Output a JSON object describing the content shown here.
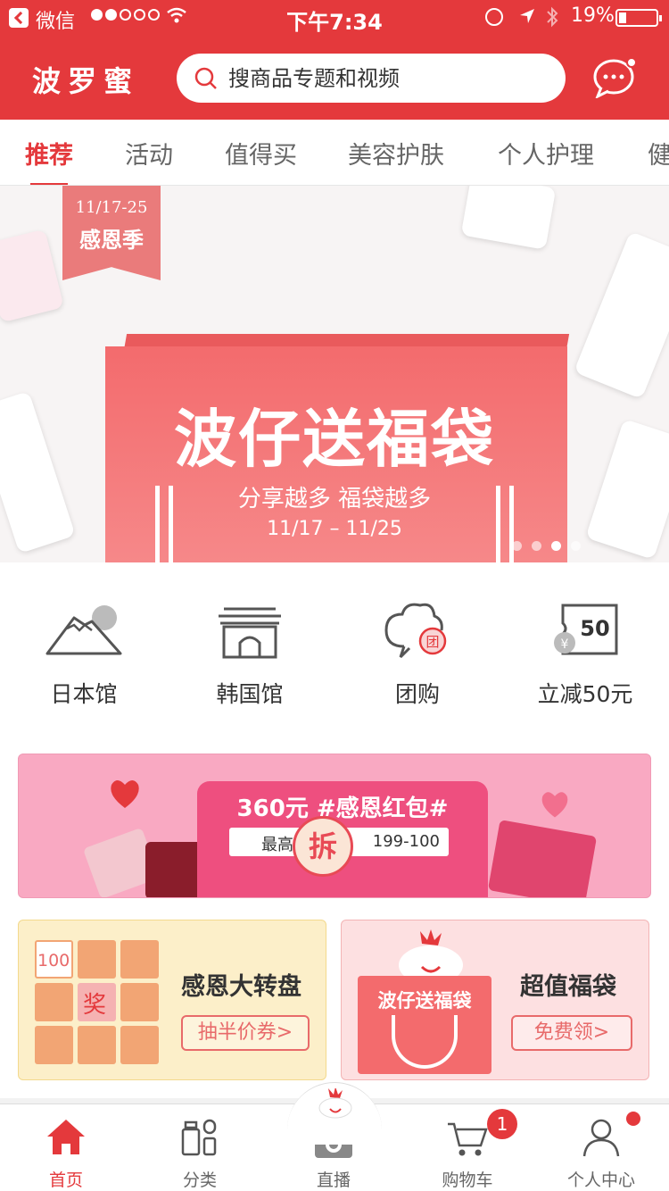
{
  "status": {
    "app": "微信",
    "time": "下午7:34",
    "battery": "19%"
  },
  "header": {
    "logo": "波罗蜜",
    "search_placeholder": "搜商品专题和视频"
  },
  "tabs": [
    "推荐",
    "活动",
    "值得买",
    "美容护肤",
    "个人护理",
    "健"
  ],
  "banner": {
    "tag_date": "11/17-25",
    "tag_name": "感恩季",
    "title": "波仔送福袋",
    "subtitle": "分享越多 福袋越多",
    "date": "11/17 – 11/25",
    "page_count": 4,
    "active_page": 3
  },
  "categories": [
    {
      "label": "日本馆",
      "icon": "mount-fuji-icon"
    },
    {
      "label": "韩国馆",
      "icon": "korean-palace-icon"
    },
    {
      "label": "团购",
      "icon": "group-buy-icon"
    },
    {
      "label": "立减50元",
      "icon": "coupon-50-icon",
      "icon_text": "50"
    }
  ],
  "promo": {
    "title": "360元 #感恩红包#",
    "slip_left": "最高满",
    "slip_right": "199-100",
    "open": "拆"
  },
  "cards": {
    "left": {
      "title": "感恩大转盘",
      "button": "抽半价券>",
      "cell_top": "100",
      "cell_center": "奖"
    },
    "right": {
      "title": "超值福袋",
      "button": "免费领>",
      "bag_text": "波仔送福袋"
    }
  },
  "tabbar": [
    {
      "label": "首页",
      "active": true
    },
    {
      "label": "分类",
      "active": false
    },
    {
      "label": "直播",
      "active": false
    },
    {
      "label": "购物车",
      "active": false,
      "badge": "1"
    },
    {
      "label": "个人中心",
      "active": false
    }
  ],
  "colors": {
    "brand": "#e4393c",
    "promo_pink": "#f9a9c2",
    "card_yellow": "#fcefc9",
    "card_pink": "#fde0e1"
  }
}
